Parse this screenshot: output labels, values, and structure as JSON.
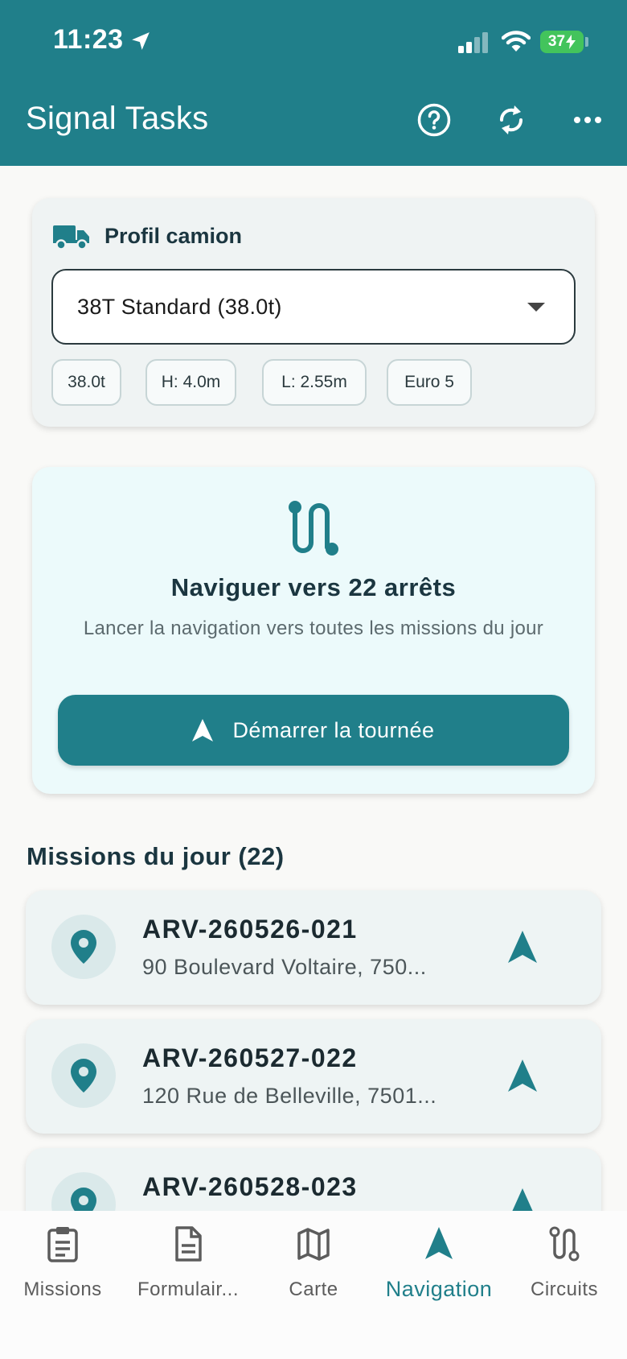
{
  "status_bar": {
    "time": "11:23",
    "battery": "37"
  },
  "app_bar": {
    "title": "Signal Tasks"
  },
  "truck_profile": {
    "title": "Profil camion",
    "selected": "38T Standard (38.0t)",
    "chips": [
      "38.0t",
      "H: 4.0m",
      "L: 2.55m",
      "Euro 5"
    ]
  },
  "navigation_card": {
    "title": "Naviguer vers 22 arrêts",
    "subtitle": "Lancer la navigation vers toutes les missions du jour",
    "button": "Démarrer la tournée"
  },
  "missions": {
    "title": "Missions du jour (22)",
    "items": [
      {
        "id": "ARV-260526-021",
        "address": "90 Boulevard Voltaire, 750..."
      },
      {
        "id": "ARV-260527-022",
        "address": "120 Rue de Belleville, 7501..."
      },
      {
        "id": "ARV-260528-023",
        "address": ""
      }
    ]
  },
  "bottom_nav": {
    "tabs": [
      {
        "label": "Missions"
      },
      {
        "label": "Formulair..."
      },
      {
        "label": "Carte"
      },
      {
        "label": "Navigation"
      },
      {
        "label": "Circuits"
      }
    ]
  },
  "colors": {
    "primary": "#207f8a",
    "nav_card_bg": "#ecfafb",
    "battery": "#43c45c"
  }
}
